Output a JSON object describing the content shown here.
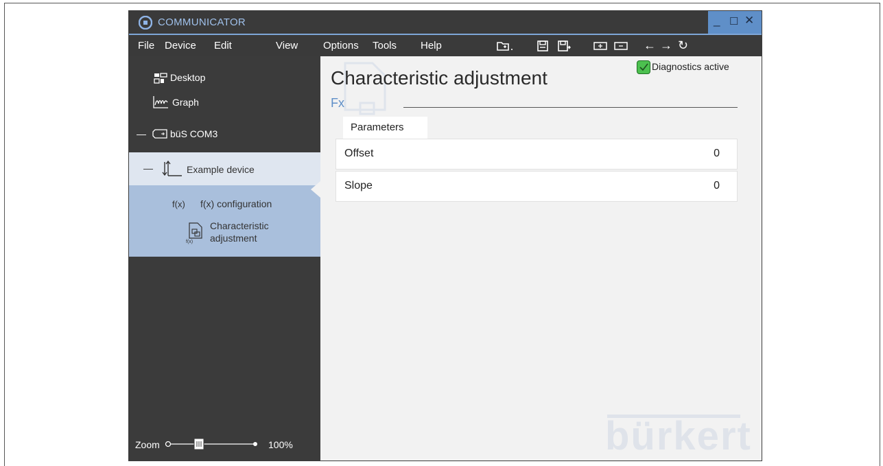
{
  "app": {
    "title": "COMMUNICATOR"
  },
  "menu": {
    "file": "File",
    "device": "Device",
    "edit": "Edit",
    "view": "View",
    "options": "Options",
    "tools": "Tools",
    "help": "Help"
  },
  "sidebar": {
    "desktop": "Desktop",
    "graph": "Graph",
    "interface": "büS COM3",
    "device": "Example device",
    "fx_prefix": "f(x)",
    "fx_config": "f(x) configuration",
    "char_line1": "Characteristic",
    "char_line2": "adjustment",
    "zoom_label": "Zoom",
    "zoom_value": "100%",
    "collapse_symbol": "—"
  },
  "main": {
    "title": "Characteristic adjustment",
    "subtitle": "Fx",
    "diagnostics": "Diagnostics active",
    "tab": "Parameters",
    "rows": [
      {
        "label": "Offset",
        "value": "0"
      },
      {
        "label": "Slope",
        "value": "0"
      }
    ],
    "watermark": "bürkert"
  },
  "colors": {
    "accent": "#5f8fc8",
    "sidebar_bg": "#3b3b3b",
    "selection": "#a9bfdc",
    "status_ok": "#4cc04f"
  }
}
